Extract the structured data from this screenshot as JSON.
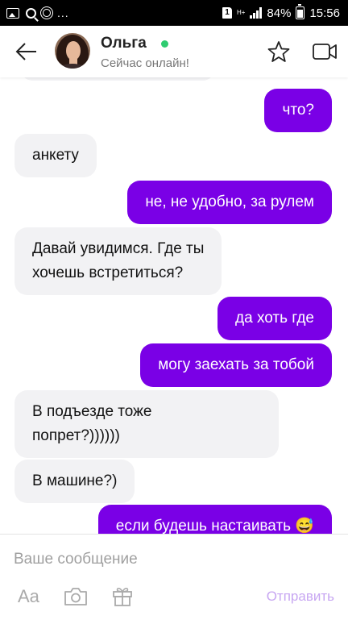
{
  "status_bar": {
    "sim_slot": "1",
    "network": "H+",
    "battery": "84%",
    "time": "15:56",
    "more": "..."
  },
  "header": {
    "contact_name": "Ольга",
    "status": "Сейчас онлайн!",
    "online_color": "#2fcc71"
  },
  "messages": [
    {
      "direction": "out",
      "text": "что?"
    },
    {
      "direction": "in",
      "text": "анкету"
    },
    {
      "direction": "out",
      "text": "не, не удобно, за рулем"
    },
    {
      "direction": "in",
      "text": "Давай увидимся. Где ты\nхочешь встретиться?"
    },
    {
      "direction": "out",
      "text": "да хоть где"
    },
    {
      "direction": "out",
      "text": "могу заехать за тобой"
    },
    {
      "direction": "in",
      "text": "В подъезде тоже\nпопрет?))))))"
    },
    {
      "direction": "in",
      "text": "В машине?)"
    },
    {
      "direction": "out",
      "text": "если будешь настаивать 😅"
    }
  ],
  "composer": {
    "placeholder": "Ваше сообщение",
    "font_label": "Aa",
    "send_label": "Отправить"
  },
  "colors": {
    "outgoing_bubble": "#7a00e6",
    "incoming_bubble": "#f2f2f4",
    "send_disabled": "#c7a6f2"
  }
}
